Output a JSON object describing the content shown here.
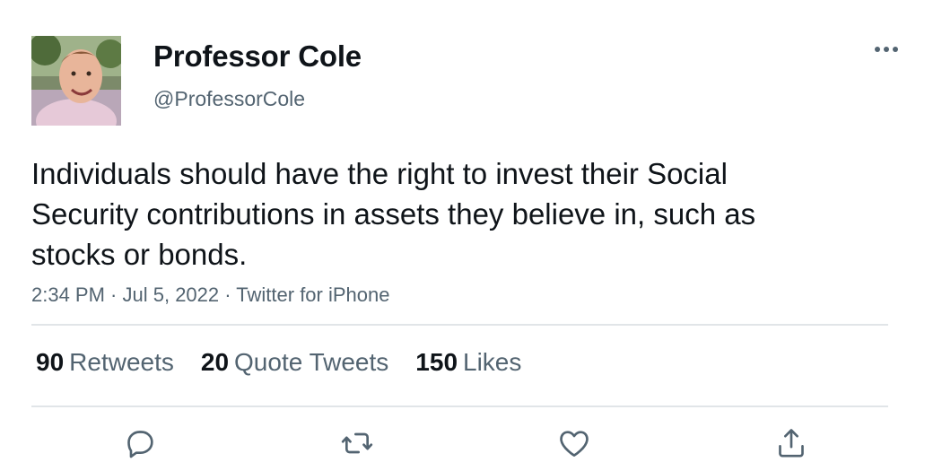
{
  "tweet": {
    "author_name": "Professor Cole",
    "author_handle": "@ProfessorCole",
    "text": "Individuals should have the right to invest their Social Security contributions in assets they believe in, such as stocks or bonds.",
    "time": "2:34 PM",
    "date": "Jul 5, 2022",
    "source": "Twitter for iPhone",
    "separator": " · "
  },
  "stats": {
    "retweets_count": "90",
    "retweets_label": "Retweets",
    "quotes_count": "20",
    "quotes_label": "Quote Tweets",
    "likes_count": "150",
    "likes_label": "Likes"
  },
  "icons": {
    "more": "more-options-icon",
    "reply": "reply-icon",
    "retweet": "retweet-icon",
    "like": "heart-icon",
    "share": "share-icon"
  },
  "colors": {
    "text_primary": "#0f1419",
    "text_secondary": "#536471",
    "divider": "#e1e5e8"
  }
}
